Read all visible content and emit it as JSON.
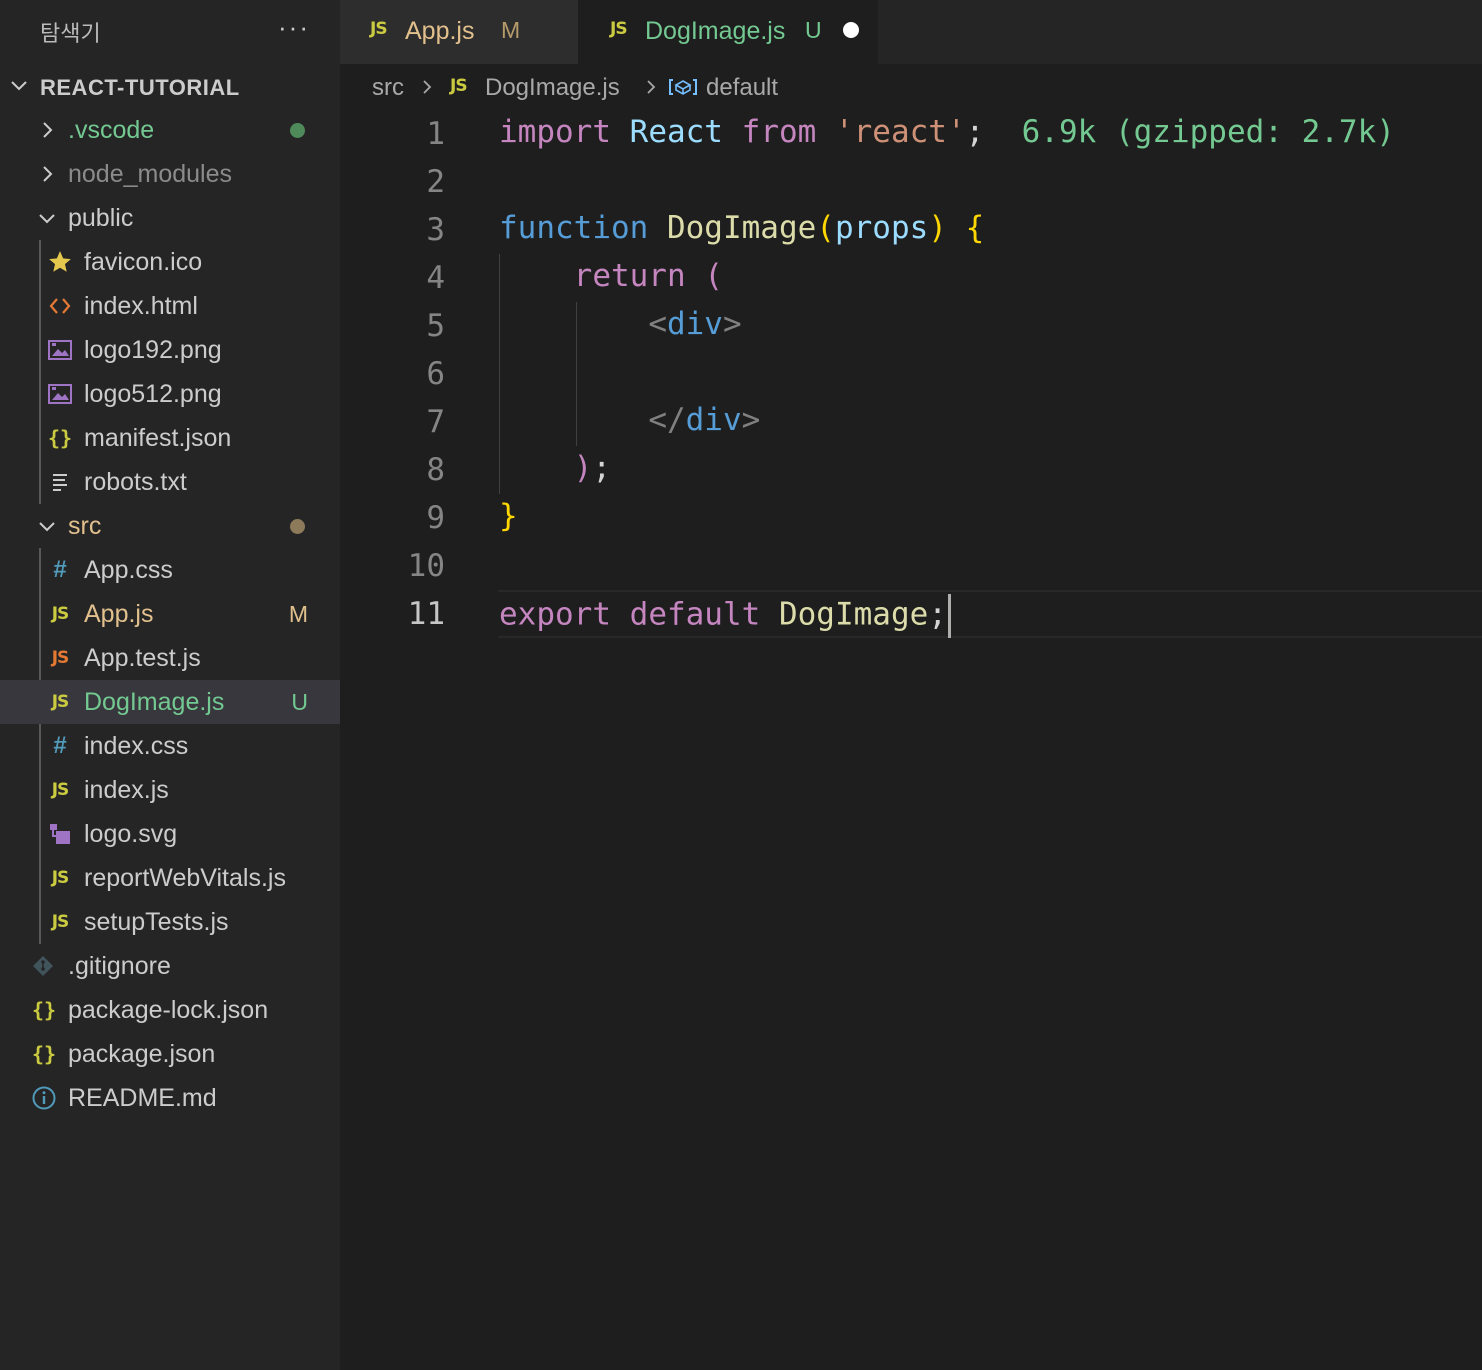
{
  "sidebar": {
    "title": "탐색기",
    "more_icon": "ellipsis-icon",
    "project_name": "REACT-TUTORIAL",
    "items": [
      {
        "label": ".vscode",
        "type": "folder-collapsed",
        "color": "#73c991",
        "status": "dot",
        "status_color": "#4f8a5b"
      },
      {
        "label": "node_modules",
        "type": "folder-collapsed",
        "color": "#8b8b8b"
      },
      {
        "label": "public",
        "type": "folder-open",
        "color": "#cccccc"
      },
      {
        "label": "favicon.ico",
        "type": "file",
        "icon": "star-icon",
        "color": "#cccccc"
      },
      {
        "label": "index.html",
        "type": "file",
        "icon": "html-icon",
        "color": "#cccccc"
      },
      {
        "label": "logo192.png",
        "type": "file",
        "icon": "image-icon",
        "color": "#cccccc"
      },
      {
        "label": "logo512.png",
        "type": "file",
        "icon": "image-icon",
        "color": "#cccccc"
      },
      {
        "label": "manifest.json",
        "type": "file",
        "icon": "json-icon",
        "color": "#cccccc"
      },
      {
        "label": "robots.txt",
        "type": "file",
        "icon": "text-icon",
        "color": "#cccccc"
      },
      {
        "label": "src",
        "type": "folder-open",
        "color": "#e2c08d",
        "status": "dot",
        "status_color": "#8c7a5a"
      },
      {
        "label": "App.css",
        "type": "file",
        "icon": "css-icon",
        "color": "#cccccc"
      },
      {
        "label": "App.js",
        "type": "file",
        "icon": "js-icon",
        "color": "#e2c08d",
        "badge": "M"
      },
      {
        "label": "App.test.js",
        "type": "file",
        "icon": "js-test-icon",
        "color": "#cccccc"
      },
      {
        "label": "DogImage.js",
        "type": "file",
        "icon": "js-icon",
        "color": "#73c991",
        "badge": "U"
      },
      {
        "label": "index.css",
        "type": "file",
        "icon": "css-icon",
        "color": "#cccccc"
      },
      {
        "label": "index.js",
        "type": "file",
        "icon": "js-icon",
        "color": "#cccccc"
      },
      {
        "label": "logo.svg",
        "type": "file",
        "icon": "svg-icon",
        "color": "#cccccc"
      },
      {
        "label": "reportWebVitals.js",
        "type": "file",
        "icon": "js-icon",
        "color": "#cccccc"
      },
      {
        "label": "setupTests.js",
        "type": "file",
        "icon": "js-icon",
        "color": "#cccccc"
      },
      {
        "label": ".gitignore",
        "type": "file",
        "icon": "git-icon",
        "color": "#cccccc"
      },
      {
        "label": "package-lock.json",
        "type": "file",
        "icon": "json-icon",
        "color": "#cccccc"
      },
      {
        "label": "package.json",
        "type": "file",
        "icon": "json-icon",
        "color": "#cccccc"
      },
      {
        "label": "README.md",
        "type": "file",
        "icon": "info-icon",
        "color": "#cccccc"
      }
    ]
  },
  "tabs": [
    {
      "icon_text": "JS",
      "label": "App.js",
      "badge": "M",
      "active": false
    },
    {
      "icon_text": "JS",
      "label": "DogImage.js",
      "badge": "U",
      "active": true,
      "unsaved": true
    }
  ],
  "breadcrumb": {
    "folder": "src",
    "file_icon": "JS",
    "file": "DogImage.js",
    "symbol": "default"
  },
  "editor": {
    "line_numbers": [
      "1",
      "2",
      "3",
      "4",
      "5",
      "6",
      "7",
      "8",
      "9",
      "10",
      "11"
    ],
    "current_line": "11",
    "code": {
      "l1_import": "import",
      "l1_react": "React",
      "l1_from": "from",
      "l1_str": "'react'",
      "l1_semi": ";",
      "l1_cost": "6.9k (gzipped: 2.7k)",
      "l3_function": "function",
      "l3_name": "DogImage",
      "l3_paren_open": "(",
      "l3_props": "props",
      "l3_paren_close": ")",
      "l3_brace": "{",
      "l4_return": "return",
      "l4_paren": "(",
      "l5_lt": "<",
      "l5_tag": "div",
      "l5_gt": ">",
      "l7_lt": "</",
      "l7_tag": "div",
      "l7_gt": ">",
      "l8_paren": ")",
      "l8_semi": ";",
      "l9_brace": "}",
      "l11_export": "export",
      "l11_default": "default",
      "l11_name": "DogImage",
      "l11_semi": ";"
    }
  }
}
